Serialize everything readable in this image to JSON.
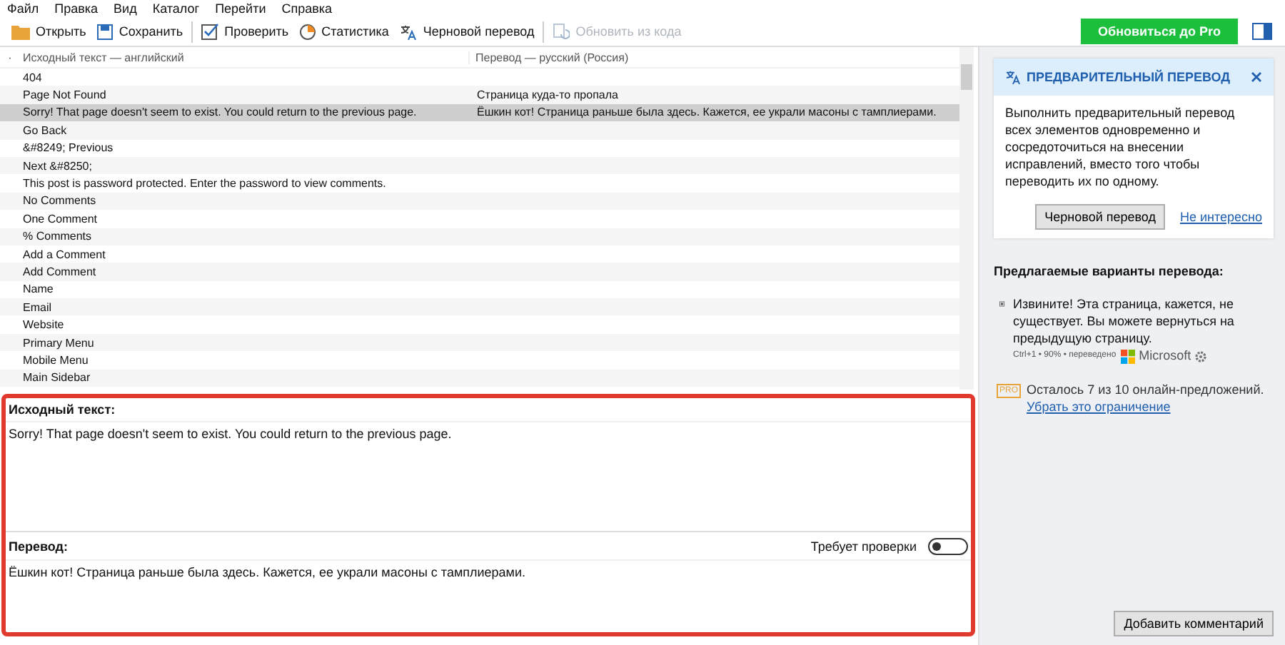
{
  "menu": [
    "Файл",
    "Правка",
    "Вид",
    "Каталог",
    "Перейти",
    "Справка"
  ],
  "toolbar": [
    {
      "label": "Открыть",
      "disabled": false,
      "sep_after": false
    },
    {
      "label": "Сохранить",
      "disabled": false,
      "sep_after": true
    },
    {
      "label": "Проверить",
      "disabled": false,
      "sep_after": false
    },
    {
      "label": "Статистика",
      "disabled": false,
      "sep_after": false
    },
    {
      "label": "Черновой перевод",
      "disabled": false,
      "sep_after": true
    },
    {
      "label": "Обновить из кода",
      "disabled": true,
      "sep_after": false
    }
  ],
  "upgrade_button": "Обновиться до Pro",
  "table": {
    "header_marker": "·",
    "columns": [
      "Исходный текст — английский",
      "Перевод — русский (Россия)"
    ],
    "rows": [
      {
        "source": "404",
        "translation": "",
        "selected": false
      },
      {
        "source": "Page  Not Found",
        "translation": "Страница куда-то пропала",
        "selected": false
      },
      {
        "source": "Sorry! That page doesn't seem to exist. You could return to the previous page.",
        "translation": "Ёшкин кот! Страница раньше была здесь. Кажется, ее украли масоны с тамплиерами.",
        "selected": true
      },
      {
        "source": "Go Back",
        "translation": "",
        "selected": false
      },
      {
        "source": "&#8249; Previous",
        "translation": "",
        "selected": false
      },
      {
        "source": "Next &#8250;",
        "translation": "",
        "selected": false
      },
      {
        "source": "This post is password protected. Enter the password to view comments.",
        "translation": "",
        "selected": false
      },
      {
        "source": "No Comments",
        "translation": "",
        "selected": false
      },
      {
        "source": "One Comment",
        "translation": "",
        "selected": false
      },
      {
        "source": "% Comments",
        "translation": "",
        "selected": false
      },
      {
        "source": "Add a Comment",
        "translation": "",
        "selected": false
      },
      {
        "source": "Add Comment",
        "translation": "",
        "selected": false
      },
      {
        "source": "Name",
        "translation": "",
        "selected": false
      },
      {
        "source": "Email",
        "translation": "",
        "selected": false
      },
      {
        "source": "Website",
        "translation": "",
        "selected": false
      },
      {
        "source": "Primary Menu",
        "translation": "",
        "selected": false
      },
      {
        "source": "Mobile Menu",
        "translation": "",
        "selected": false
      },
      {
        "source": "Main Sidebar",
        "translation": "",
        "selected": false
      }
    ]
  },
  "editor": {
    "source_label": "Исходный текст:",
    "source_text": "Sorry! That page doesn't seem to exist. You could return to the previous page.",
    "translation_label": "Перевод:",
    "needs_review_label": "Требует проверки",
    "needs_review_on": false,
    "translation_text": "Ёшкин кот! Страница раньше была здесь. Кажется, ее украли масоны с тамплиерами."
  },
  "side_panel": {
    "card": {
      "title": "ПРЕДВАРИТЕЛЬНЫЙ ПЕРЕВОД",
      "body": "Выполнить предварительный перевод всех элементов одновременно и сосредоточиться на внесении исправлений, вместо того чтобы переводить их по одному.",
      "button": "Черновой перевод",
      "link": "Не интересно"
    },
    "suggestions_title": "Предлагаемые варианты перевода:",
    "suggestions": [
      {
        "text": "Извините! Эта страница, кажется, не существует. Вы можете вернуться на предыдущую страницу.",
        "meta": "Ctrl+1 • 90% • переведено",
        "provider": "Microsoft"
      }
    ],
    "pro_badge": "PRO",
    "pro_note": "Осталось 7 из 10 онлайн-предложений.",
    "pro_link": "Убрать это ограничение",
    "comment_button": "Добавить комментарий"
  }
}
